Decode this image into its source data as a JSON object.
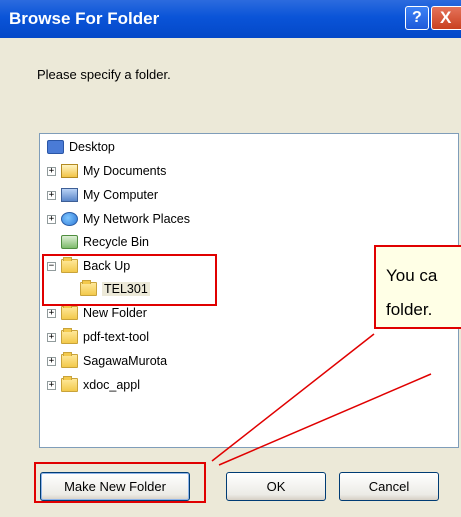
{
  "window": {
    "title": "Browse For Folder",
    "help_glyph": "?",
    "close_glyph": "X"
  },
  "prompt": "Please specify a folder.",
  "tree": {
    "items": [
      {
        "label": "Desktop",
        "icon": "desktop-icon",
        "expander": ""
      },
      {
        "label": "My Documents",
        "icon": "my-documents-icon",
        "expander": "+"
      },
      {
        "label": "My Computer",
        "icon": "my-computer-icon",
        "expander": "+"
      },
      {
        "label": "My Network Places",
        "icon": "network-places-icon",
        "expander": "+"
      },
      {
        "label": "Recycle Bin",
        "icon": "recycle-bin-icon",
        "expander": ""
      },
      {
        "label": "Back Up",
        "icon": "folder-icon",
        "expander": "−"
      },
      {
        "label": "TEL301",
        "icon": "folder-icon",
        "expander": ""
      },
      {
        "label": "New Folder",
        "icon": "folder-icon",
        "expander": "+"
      },
      {
        "label": "pdf-text-tool",
        "icon": "folder-icon",
        "expander": "+"
      },
      {
        "label": "SagawaMurota",
        "icon": "folder-icon",
        "expander": "+"
      },
      {
        "label": "xdoc_appl",
        "icon": "folder-icon",
        "expander": "+"
      }
    ]
  },
  "callout": {
    "line1": "You ca",
    "line2": "folder."
  },
  "buttons": {
    "make_new_folder": "Make New Folder",
    "ok": "OK",
    "cancel": "Cancel"
  },
  "colors": {
    "title_bar": "#0A54D8",
    "annotation_red": "#E00000",
    "dialog_bg": "#ECE9D8"
  }
}
